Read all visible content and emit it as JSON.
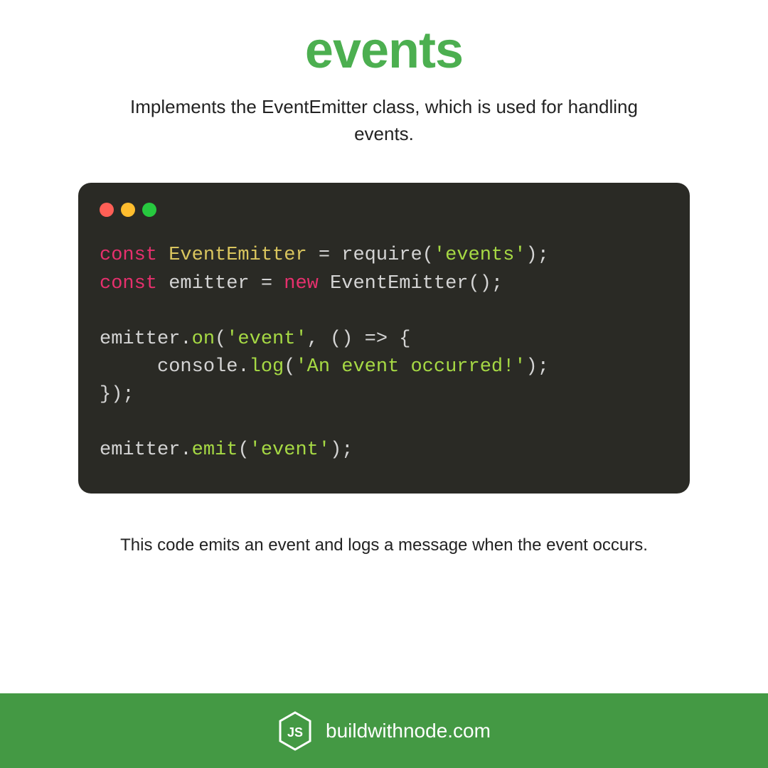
{
  "title": "events",
  "description": "Implements the EventEmitter class, which is used for handling events.",
  "caption": "This code emits an event and logs a message when the event occurs.",
  "footer_text": "buildwithnode.com",
  "code": {
    "k_const1": "const",
    "cls_evemit": "EventEmitter",
    "eq_req": " = require(",
    "str_events": "'events'",
    "close_req": ");",
    "k_const2": "const",
    "var_emitter": " emitter = ",
    "k_new": "new",
    "ctor": " EventEmitter();",
    "l3a": "emitter.",
    "fn_on": "on",
    "l3b": "(",
    "str_event": "'event'",
    "l3c": ", () => {",
    "l4a": "     console.",
    "fn_log": "log",
    "l4b": "(",
    "str_occ": "'An event occurred!'",
    "l4c": ");",
    "l5": "});",
    "l6a": "emitter.",
    "fn_emit": "emit",
    "l6b": "(",
    "str_event2": "'event'",
    "l6c": ");"
  }
}
